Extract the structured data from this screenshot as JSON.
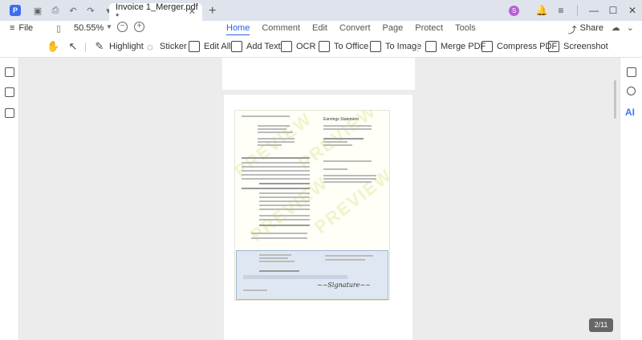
{
  "titlebar": {
    "tab_title": "Invoice 1_Merger.pdf *",
    "avatar_initial": "S"
  },
  "menubar": {
    "file_label": "File",
    "zoom_value": "50.55%",
    "menus": [
      "Home",
      "Comment",
      "Edit",
      "Convert",
      "Page",
      "Protect",
      "Tools"
    ],
    "active_menu": "Home",
    "share_label": "Share"
  },
  "toolbar": {
    "highlight": "Highlight",
    "sticker": "Sticker",
    "edit_all": "Edit All",
    "add_text": "Add Text",
    "ocr": "OCR",
    "to_office": "To Office",
    "to_image": "To Image",
    "merge_pdf": "Merge PDF",
    "compress_pdf": "Compress PDF",
    "screenshot": "Screenshot"
  },
  "document": {
    "stub_title": "Earnings Statement",
    "watermark": "PREVIEW"
  },
  "rightbar": {
    "ai_label": "AI"
  },
  "status": {
    "page_indicator": "2/11"
  }
}
